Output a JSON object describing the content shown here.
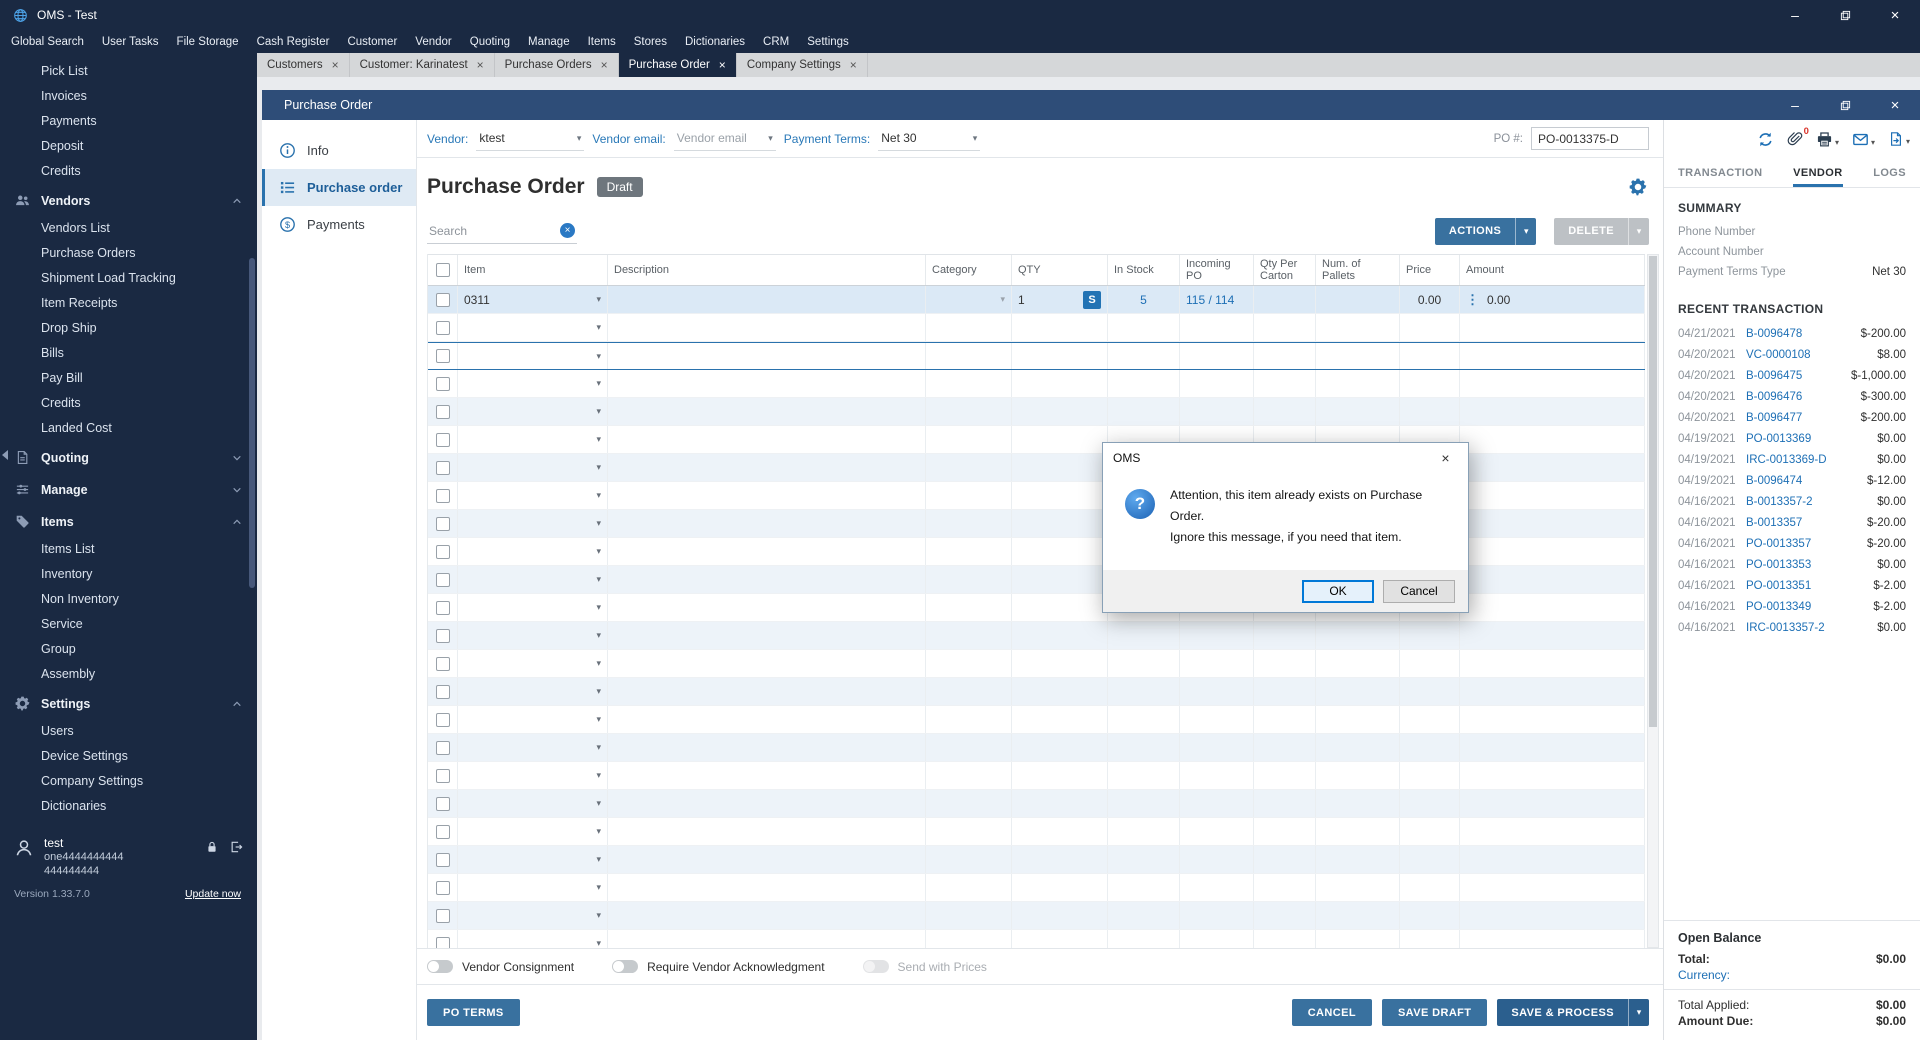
{
  "app": {
    "title": "OMS - Test"
  },
  "menu": {
    "items": [
      "Global Search",
      "User Tasks",
      "File Storage",
      "Cash Register",
      "Customer",
      "Vendor",
      "Quoting",
      "Manage",
      "Items",
      "Stores",
      "Dictionaries",
      "CRM",
      "Settings"
    ]
  },
  "tabs": [
    {
      "label": "Customers",
      "active": false
    },
    {
      "label": "Customer: Karinatest",
      "active": false
    },
    {
      "label": "Purchase Orders",
      "active": false
    },
    {
      "label": "Purchase Order",
      "active": true
    },
    {
      "label": "Company Settings",
      "active": false
    }
  ],
  "sidebar": {
    "items": [
      {
        "type": "sub",
        "label": "Pick List"
      },
      {
        "type": "sub",
        "label": "Invoices"
      },
      {
        "type": "sub",
        "label": "Payments"
      },
      {
        "type": "sub",
        "label": "Deposit"
      },
      {
        "type": "sub",
        "label": "Credits"
      },
      {
        "type": "section",
        "label": "Vendors",
        "icon": "people",
        "chevron": "up"
      },
      {
        "type": "sub",
        "label": "Vendors List"
      },
      {
        "type": "sub",
        "label": "Purchase Orders"
      },
      {
        "type": "sub",
        "label": "Shipment Load Tracking"
      },
      {
        "type": "sub",
        "label": "Item Receipts"
      },
      {
        "type": "sub",
        "label": "Drop Ship"
      },
      {
        "type": "sub",
        "label": "Bills"
      },
      {
        "type": "sub",
        "label": "Pay Bill"
      },
      {
        "type": "sub",
        "label": "Credits"
      },
      {
        "type": "sub",
        "label": "Landed Cost"
      },
      {
        "type": "section",
        "label": "Quoting",
        "icon": "quote",
        "chevron": "down"
      },
      {
        "type": "section",
        "label": "Manage",
        "icon": "manage",
        "chevron": "down"
      },
      {
        "type": "section",
        "label": "Items",
        "icon": "tag",
        "chevron": "up"
      },
      {
        "type": "sub",
        "label": "Items List"
      },
      {
        "type": "sub",
        "label": "Inventory"
      },
      {
        "type": "sub",
        "label": "Non Inventory"
      },
      {
        "type": "sub",
        "label": "Service"
      },
      {
        "type": "sub",
        "label": "Group"
      },
      {
        "type": "sub",
        "label": "Assembly"
      },
      {
        "type": "section",
        "label": "Settings",
        "icon": "gear",
        "chevron": "up"
      },
      {
        "type": "sub",
        "label": "Users"
      },
      {
        "type": "sub",
        "label": "Device Settings"
      },
      {
        "type": "sub",
        "label": "Company Settings"
      },
      {
        "type": "sub",
        "label": "Dictionaries"
      }
    ],
    "user": {
      "name": "test",
      "line1": "one4444444444",
      "line2": "444444444"
    },
    "version": "Version 1.33.7.0",
    "update_link": "Update now"
  },
  "po": {
    "window_title": "Purchase Order",
    "nav": [
      {
        "label": "Info",
        "icon": "info",
        "active": false
      },
      {
        "label": "Purchase order",
        "icon": "list",
        "active": true
      },
      {
        "label": "Payments",
        "icon": "dollar",
        "active": false
      }
    ],
    "form": {
      "vendor_label": "Vendor:",
      "vendor_value": "ktest",
      "email_label": "Vendor email:",
      "email_placeholder": "Vendor email",
      "terms_label": "Payment Terms:",
      "terms_value": "Net 30",
      "po_label": "PO #:",
      "po_value": "PO-0013375-D"
    },
    "heading": {
      "title": "Purchase Order",
      "badge": "Draft"
    },
    "toolbar": {
      "search_placeholder": "Search",
      "actions": "ACTIONS",
      "delete": "DELETE"
    },
    "table": {
      "columns": [
        "Item",
        "Description",
        "Category",
        "QTY",
        "In Stock",
        "Incoming PO",
        "Qty Per Carton",
        "Num. of Pallets",
        "Price",
        "Amount"
      ],
      "row": {
        "item": "0311",
        "qty": "1",
        "qty_badge": "S",
        "in_stock": "5",
        "incoming_po": "115 / 114",
        "price": "0.00",
        "amount": "0.00"
      },
      "empty_rows": 23
    },
    "toggles": [
      {
        "label": "Vendor Consignment",
        "disabled": false
      },
      {
        "label": "Require Vendor Acknowledgment",
        "disabled": false
      },
      {
        "label": "Send with Prices",
        "disabled": true
      }
    ],
    "footer": {
      "po_terms": "PO TERMS",
      "cancel": "CANCEL",
      "save_draft": "SAVE DRAFT",
      "save_process": "SAVE & PROCESS"
    }
  },
  "panel": {
    "attachments_count": "0",
    "tabs": [
      {
        "label": "TRANSACTION",
        "active": false
      },
      {
        "label": "VENDOR",
        "active": true
      },
      {
        "label": "LOGS",
        "active": false
      }
    ],
    "summary_heading": "SUMMARY",
    "summary_rows": [
      {
        "label": "Phone Number",
        "value": ""
      },
      {
        "label": "Account Number",
        "value": ""
      },
      {
        "label": "Payment Terms Type",
        "value": "Net 30"
      }
    ],
    "recent_heading": "RECENT TRANSACTION",
    "transactions": [
      {
        "date": "04/21/2021",
        "id": "B-0096478",
        "amount": "$-200.00"
      },
      {
        "date": "04/20/2021",
        "id": "VC-0000108",
        "amount": "$8.00"
      },
      {
        "date": "04/20/2021",
        "id": "B-0096475",
        "amount": "$-1,000.00"
      },
      {
        "date": "04/20/2021",
        "id": "B-0096476",
        "amount": "$-300.00"
      },
      {
        "date": "04/20/2021",
        "id": "B-0096477",
        "amount": "$-200.00"
      },
      {
        "date": "04/19/2021",
        "id": "PO-0013369",
        "amount": "$0.00"
      },
      {
        "date": "04/19/2021",
        "id": "IRC-0013369-D",
        "amount": "$0.00"
      },
      {
        "date": "04/19/2021",
        "id": "B-0096474",
        "amount": "$-12.00"
      },
      {
        "date": "04/16/2021",
        "id": "B-0013357-2",
        "amount": "$0.00"
      },
      {
        "date": "04/16/2021",
        "id": "B-0013357",
        "amount": "$-20.00"
      },
      {
        "date": "04/16/2021",
        "id": "PO-0013357",
        "amount": "$-20.00"
      },
      {
        "date": "04/16/2021",
        "id": "PO-0013353",
        "amount": "$0.00"
      },
      {
        "date": "04/16/2021",
        "id": "PO-0013351",
        "amount": "$-2.00"
      },
      {
        "date": "04/16/2021",
        "id": "PO-0013349",
        "amount": "$-2.00"
      },
      {
        "date": "04/16/2021",
        "id": "IRC-0013357-2",
        "amount": "$0.00"
      }
    ],
    "balance": {
      "heading": "Open Balance",
      "total_label": "Total:",
      "total_value": "$0.00",
      "currency_label": "Currency:",
      "applied_label": "Total Applied:",
      "applied_value": "$0.00",
      "due_label": "Amount Due:",
      "due_value": "$0.00"
    }
  },
  "dialog": {
    "title": "OMS",
    "line1": "Attention, this item already exists on Purchase Order.",
    "line2": "Ignore this message, if you need that item.",
    "ok": "OK",
    "cancel": "Cancel"
  },
  "colors": {
    "navy": "#1a2942",
    "window_titlebar": "#2e4d78",
    "accent": "#1d6fb5",
    "button": "#39719f",
    "button_dark": "#2b5f8e",
    "disabled_button": "#bdc1c5",
    "badge_red": "#d9342b",
    "draft_badge": "#6e767d",
    "row_alt": "#edf3f9",
    "row_selected": "#dbe9f6"
  }
}
